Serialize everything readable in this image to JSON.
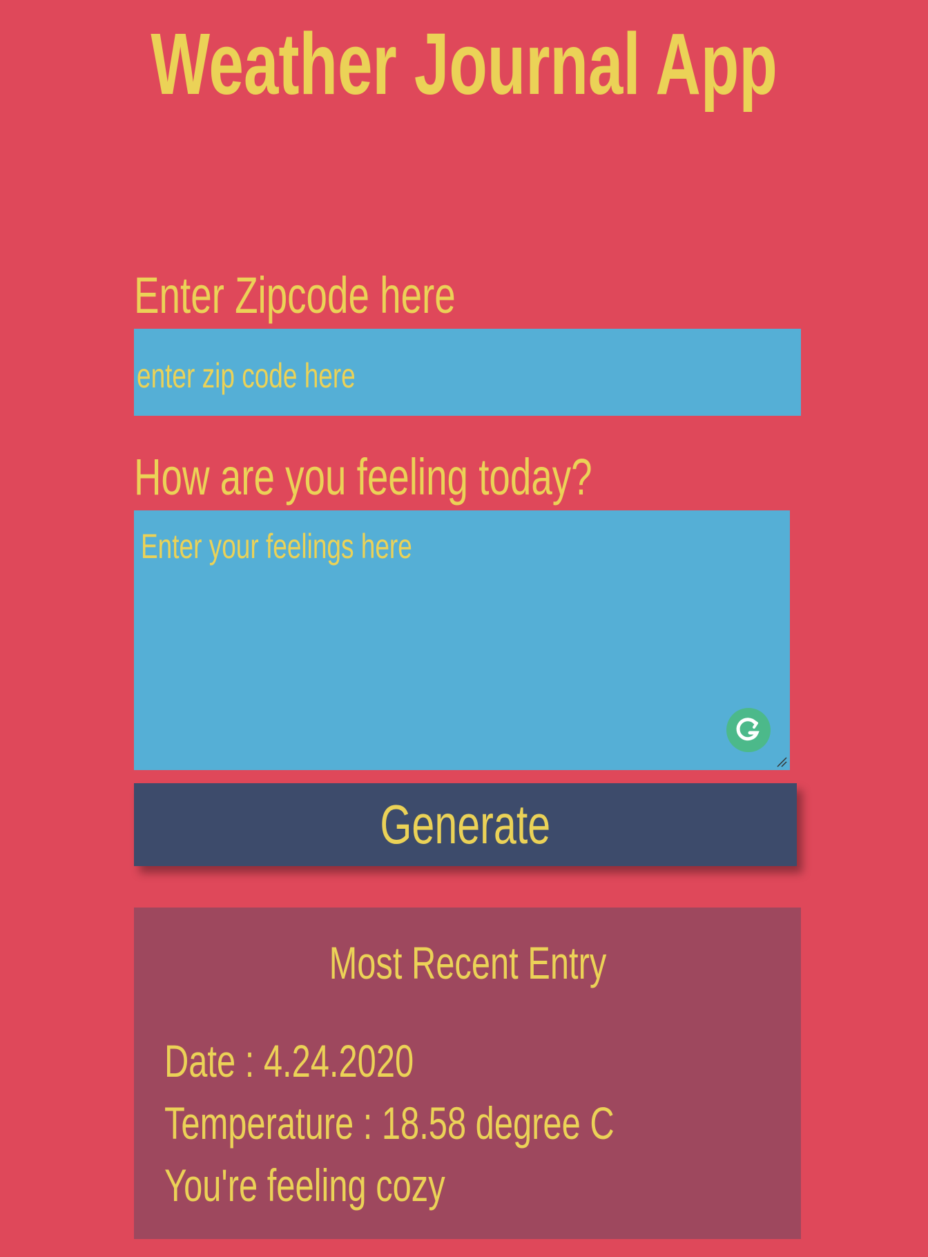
{
  "header": {
    "title": "Weather Journal App"
  },
  "form": {
    "zip_label": "Enter Zipcode here",
    "zip_placeholder": "enter zip code here",
    "zip_value": "",
    "feelings_label": "How are you feeling today?",
    "feelings_placeholder": "Enter your feelings here",
    "feelings_value": "",
    "generate_label": "Generate"
  },
  "entry": {
    "title": "Most Recent Entry",
    "date": "Date : 4.24.2020",
    "temperature": "Temperature : 18.58 degree C",
    "content": "You're feeling cozy"
  },
  "colors": {
    "background": "#df485a",
    "text": "#ebd257",
    "input_bg": "#55afd6",
    "button_bg": "#3d4b6b",
    "panel_bg": "#9e485e",
    "grammarly": "#4cb98a"
  },
  "icons": {
    "grammarly": "grammarly-g-icon",
    "resize": "resize-handle-icon"
  }
}
